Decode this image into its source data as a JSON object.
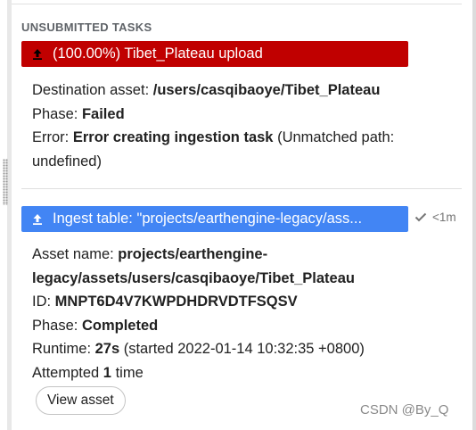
{
  "section_title": "UNSUBMITTED TASKS",
  "task1": {
    "bar_label": "(100.00%) Tibet_Plateau upload",
    "icon": "upload-icon",
    "color": "#c00000",
    "dest_label": "Destination asset: ",
    "dest_value": "/users/casqibaoye/Tibet_Plateau",
    "phase_label": "Phase: ",
    "phase_value": "Failed",
    "error_label": "Error: ",
    "error_value": "Error creating ingestion task",
    "error_detail": " (Unmatched path: undefined)"
  },
  "task2": {
    "bar_label": "Ingest table: \"projects/earthengine-legacy/ass...",
    "icon": "upload-icon",
    "color": "#4285f4",
    "status_icon": "check-icon",
    "status_text": "<1m",
    "asset_label": "Asset name: ",
    "asset_value": "projects/earthengine-legacy/assets/users/casqibaoye/Tibet_Plateau",
    "id_label": "ID: ",
    "id_value": "MNPT6D4V7KWPDHDRVDTFSQSV",
    "phase_label": "Phase: ",
    "phase_value": "Completed",
    "runtime_label": "Runtime: ",
    "runtime_value": "27s",
    "runtime_detail": " (started 2022-01-14 10:32:35 +0800)",
    "attempted_label": "Attempted ",
    "attempted_count": "1",
    "attempted_suffix": " time",
    "view_button": "View asset"
  },
  "watermark": "CSDN @By_Q"
}
